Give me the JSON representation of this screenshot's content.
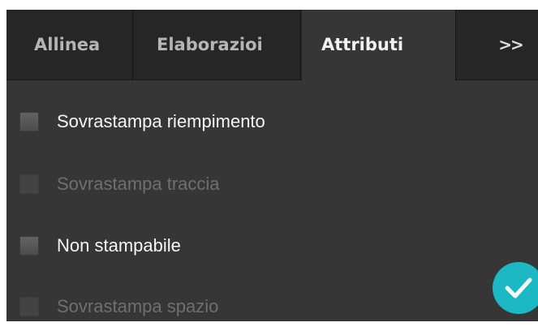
{
  "tabs": [
    {
      "label": "Allinea",
      "active": false
    },
    {
      "label": "Elaborazioi",
      "active": false
    },
    {
      "label": "Attributi",
      "active": true
    }
  ],
  "more_label": ">>",
  "options": [
    {
      "label": "Sovrastampa riempimento",
      "enabled": true,
      "checked": false
    },
    {
      "label": "Sovrastampa traccia",
      "enabled": false,
      "checked": false
    },
    {
      "label": "Non stampabile",
      "enabled": true,
      "checked": false
    },
    {
      "label": "Sovrastampa spazio",
      "enabled": false,
      "checked": false
    }
  ],
  "colors": {
    "panel": "#363636",
    "tabbar": "#262626",
    "badge": "#1cb8c4"
  },
  "badge_icon": "checkmark-icon"
}
